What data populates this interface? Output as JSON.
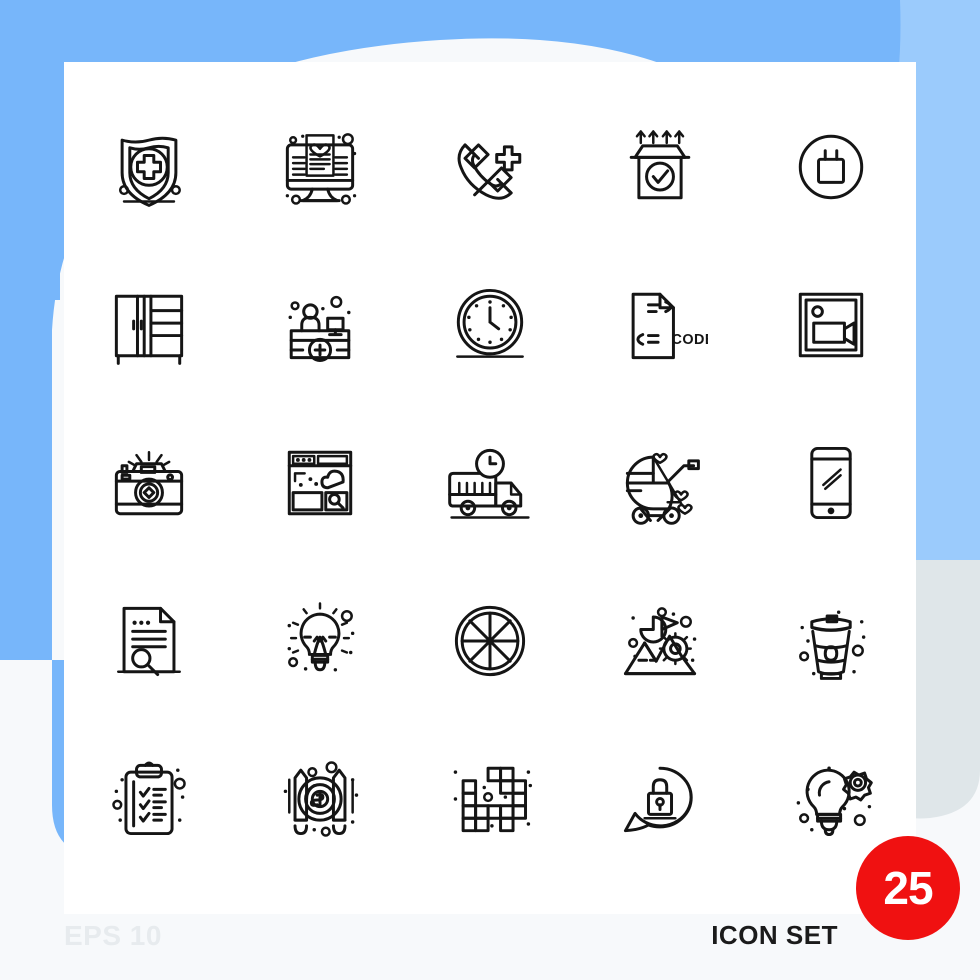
{
  "meta": {
    "eps_label": "EPS 10",
    "set_label": "ICON SET",
    "count_badge": "25",
    "code_label": "CODE"
  },
  "colors": {
    "page_background": "#f7f9fb",
    "card_background": "#ffffff",
    "blue_dark": "#77b6fa",
    "blue_light": "#9bcbfc",
    "gray_blob": "#dfe6e9",
    "icon_stroke": "#151515",
    "badge_red": "#f01111",
    "eps_text": "#e7ebee",
    "set_text": "#1b1b1b"
  },
  "grid": {
    "columns": 5,
    "rows": 5,
    "total": 25
  },
  "icons": [
    {
      "index": 1,
      "name": "medical-shield-icon",
      "label": "Medical Shield"
    },
    {
      "index": 2,
      "name": "health-website-monitor-icon",
      "label": "Health Website Monitor"
    },
    {
      "index": 3,
      "name": "emergency-call-icon",
      "label": "Emergency Call"
    },
    {
      "index": 4,
      "name": "verified-package-box-icon",
      "label": "Verified Package Box"
    },
    {
      "index": 5,
      "name": "power-adapter-circle-icon",
      "label": "Power Adapter"
    },
    {
      "index": 6,
      "name": "wardrobe-cabinet-icon",
      "label": "Wardrobe Cabinet"
    },
    {
      "index": 7,
      "name": "reception-desk-icon",
      "label": "Reception Desk"
    },
    {
      "index": 8,
      "name": "wall-clock-icon",
      "label": "Wall Clock"
    },
    {
      "index": 9,
      "name": "code-file-icon",
      "label": "Code File"
    },
    {
      "index": 10,
      "name": "video-camera-frame-icon",
      "label": "Video Camera"
    },
    {
      "index": 11,
      "name": "photo-camera-flash-icon",
      "label": "Photo Camera"
    },
    {
      "index": 12,
      "name": "browser-cloud-search-icon",
      "label": "Browser Cloud Search"
    },
    {
      "index": 13,
      "name": "delivery-truck-time-icon",
      "label": "Delivery Truck Time"
    },
    {
      "index": 14,
      "name": "baby-stroller-icon",
      "label": "Baby Stroller"
    },
    {
      "index": 15,
      "name": "smartphone-icon",
      "label": "Smartphone"
    },
    {
      "index": 16,
      "name": "document-search-icon",
      "label": "Document Search"
    },
    {
      "index": 17,
      "name": "light-bulb-idea-icon",
      "label": "Light Bulb Idea"
    },
    {
      "index": 18,
      "name": "wheel-segments-icon",
      "label": "Segmented Wheel"
    },
    {
      "index": 19,
      "name": "mountain-goal-flag-icon",
      "label": "Mountain Goal Flag"
    },
    {
      "index": 20,
      "name": "coffee-cup-icon",
      "label": "Coffee Cup"
    },
    {
      "index": 21,
      "name": "clipboard-checklist-icon",
      "label": "Clipboard Checklist"
    },
    {
      "index": 22,
      "name": "money-coin-pencils-icon",
      "label": "Money Coin Pencils"
    },
    {
      "index": 23,
      "name": "crossword-blocks-icon",
      "label": "Crossword Blocks"
    },
    {
      "index": 24,
      "name": "secure-chat-lock-icon",
      "label": "Secure Chat Lock"
    },
    {
      "index": 25,
      "name": "bulb-gear-innovation-icon",
      "label": "Bulb Gear Innovation"
    }
  ]
}
